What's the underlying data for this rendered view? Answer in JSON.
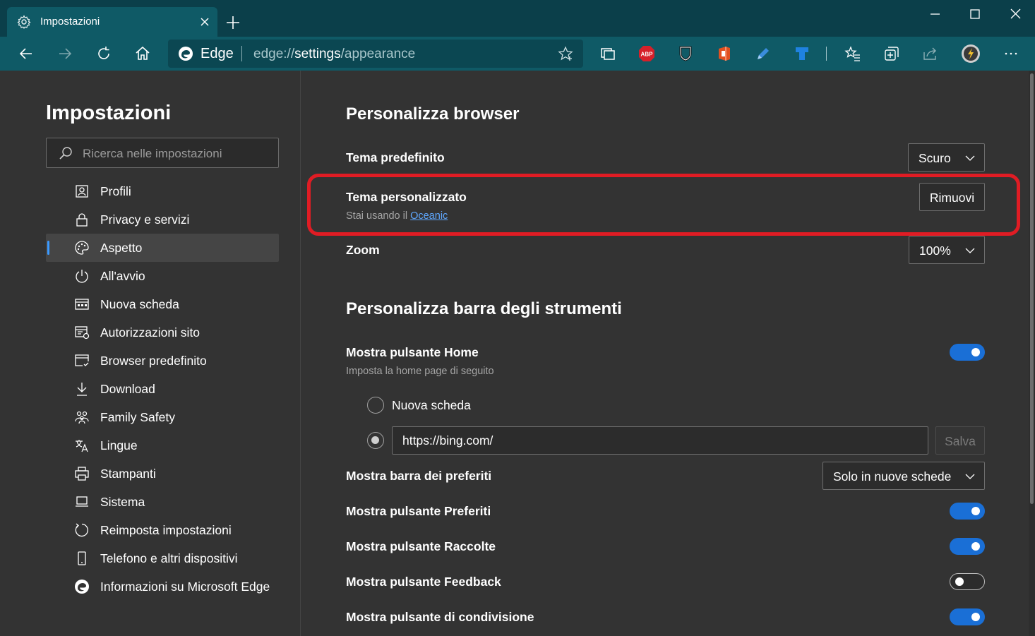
{
  "browser": {
    "tab_title": "Impostazioni",
    "site_name": "Edge",
    "url_protocol": "edge://",
    "url_host": "settings",
    "url_path": "/appearance",
    "abp_label": "ABP"
  },
  "sidebar": {
    "title": "Impostazioni",
    "search_placeholder": "Ricerca nelle impostazioni",
    "items": [
      {
        "label": "Profili",
        "icon": "profile-icon"
      },
      {
        "label": "Privacy e servizi",
        "icon": "lock-icon"
      },
      {
        "label": "Aspetto",
        "icon": "palette-icon",
        "active": true
      },
      {
        "label": "All'avvio",
        "icon": "power-icon"
      },
      {
        "label": "Nuova scheda",
        "icon": "new-tab-page-icon"
      },
      {
        "label": "Autorizzazioni sito",
        "icon": "site-permissions-icon"
      },
      {
        "label": "Browser predefinito",
        "icon": "default-browser-icon"
      },
      {
        "label": "Download",
        "icon": "download-icon"
      },
      {
        "label": "Family Safety",
        "icon": "family-icon"
      },
      {
        "label": "Lingue",
        "icon": "language-icon"
      },
      {
        "label": "Stampanti",
        "icon": "printer-icon"
      },
      {
        "label": "Sistema",
        "icon": "laptop-icon"
      },
      {
        "label": "Reimposta impostazioni",
        "icon": "reset-icon"
      },
      {
        "label": "Telefono e altri dispositivi",
        "icon": "phone-icon"
      },
      {
        "label": "Informazioni su Microsoft Edge",
        "icon": "edge-logo-icon"
      }
    ]
  },
  "main": {
    "section_browser": "Personalizza browser",
    "default_theme_label": "Tema predefinito",
    "default_theme_value": "Scuro",
    "custom_theme_label": "Tema personalizzato",
    "custom_theme_sub_prefix": "Stai usando il",
    "custom_theme_link": "Oceanic",
    "remove_button": "Rimuovi",
    "zoom_label": "Zoom",
    "zoom_value": "100%",
    "section_toolbar": "Personalizza barra degli strumenti",
    "home_button_label": "Mostra pulsante Home",
    "home_button_sub": "Imposta la home page di seguito",
    "home_button_on": true,
    "radio_new_tab": "Nuova scheda",
    "home_url_value": "https://bing.com/",
    "save_button": "Salva",
    "favorites_bar_label": "Mostra barra dei preferiti",
    "favorites_bar_value": "Solo in nuove schede",
    "favorites_button_label": "Mostra pulsante Preferiti",
    "favorites_button_on": true,
    "collections_button_label": "Mostra pulsante Raccolte",
    "collections_button_on": true,
    "feedback_button_label": "Mostra pulsante Feedback",
    "feedback_button_on": false,
    "share_button_label": "Mostra pulsante di condivisione",
    "share_button_on": true
  },
  "colors": {
    "titlebar": "#0b3f4a",
    "toolbar": "#0f5a66",
    "background": "#333333",
    "toggle_on": "#1a6fd6",
    "highlight": "#e01c24",
    "link": "#5fa8ff"
  }
}
